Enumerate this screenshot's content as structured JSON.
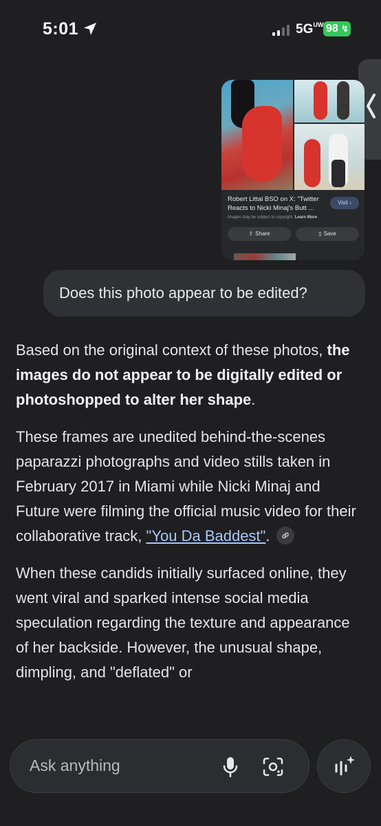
{
  "status_bar": {
    "time": "5:01",
    "network": "5G",
    "network_superscript": "UW",
    "battery": "98"
  },
  "image_card": {
    "title": "Robert Littal BSO on X: \"Twitter Reacts to Nicki Minaj's Butt ...",
    "visit_label": "Visit",
    "copyright_text": "Images may be subject to copyright.",
    "learn_more": "Learn More",
    "share_label": "Share",
    "save_label": "Save"
  },
  "user_message": "Does this photo appear to be edited?",
  "response": {
    "p1_plain": "Based on the original context of these photos, ",
    "p1_bold": "the images do not appear to be digitally edited or photoshopped to alter her shape",
    "p1_end": ".",
    "p2_plain": "These frames are unedited behind-the-scenes paparazzi photographs and video stills taken in February 2017 in Miami while Nicki Minaj and Future were filming the official music video for their collaborative track, ",
    "p2_link": "\"You Da Baddest\"",
    "p2_end": ".",
    "p3": "When these candids initially surfaced online, they went viral and sparked intense social media speculation regarding the texture and appearance of her backside. However, the unusual shape, dimpling, and \"deflated\" or"
  },
  "input": {
    "placeholder": "Ask anything"
  },
  "icons": {
    "location": "location-arrow-icon",
    "signal": "signal-bars-icon",
    "side_handle": "chevron-left-icon",
    "mic": "mic-icon",
    "lens": "lens-camera-icon",
    "voice": "voice-sparkle-icon",
    "link": "link-icon"
  },
  "colors": {
    "background": "#1f1f21",
    "bubble": "#303134",
    "link": "#a8c7fa",
    "battery": "#34c759"
  }
}
